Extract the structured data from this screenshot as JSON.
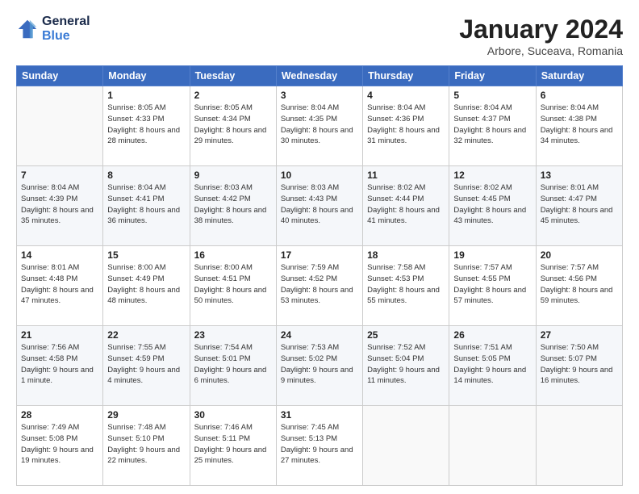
{
  "header": {
    "logo_line1": "General",
    "logo_line2": "Blue",
    "month": "January 2024",
    "location": "Arbore, Suceava, Romania"
  },
  "weekdays": [
    "Sunday",
    "Monday",
    "Tuesday",
    "Wednesday",
    "Thursday",
    "Friday",
    "Saturday"
  ],
  "weeks": [
    [
      {
        "day": "",
        "sunrise": "",
        "sunset": "",
        "daylight": ""
      },
      {
        "day": "1",
        "sunrise": "Sunrise: 8:05 AM",
        "sunset": "Sunset: 4:33 PM",
        "daylight": "Daylight: 8 hours and 28 minutes."
      },
      {
        "day": "2",
        "sunrise": "Sunrise: 8:05 AM",
        "sunset": "Sunset: 4:34 PM",
        "daylight": "Daylight: 8 hours and 29 minutes."
      },
      {
        "day": "3",
        "sunrise": "Sunrise: 8:04 AM",
        "sunset": "Sunset: 4:35 PM",
        "daylight": "Daylight: 8 hours and 30 minutes."
      },
      {
        "day": "4",
        "sunrise": "Sunrise: 8:04 AM",
        "sunset": "Sunset: 4:36 PM",
        "daylight": "Daylight: 8 hours and 31 minutes."
      },
      {
        "day": "5",
        "sunrise": "Sunrise: 8:04 AM",
        "sunset": "Sunset: 4:37 PM",
        "daylight": "Daylight: 8 hours and 32 minutes."
      },
      {
        "day": "6",
        "sunrise": "Sunrise: 8:04 AM",
        "sunset": "Sunset: 4:38 PM",
        "daylight": "Daylight: 8 hours and 34 minutes."
      }
    ],
    [
      {
        "day": "7",
        "sunrise": "Sunrise: 8:04 AM",
        "sunset": "Sunset: 4:39 PM",
        "daylight": "Daylight: 8 hours and 35 minutes."
      },
      {
        "day": "8",
        "sunrise": "Sunrise: 8:04 AM",
        "sunset": "Sunset: 4:41 PM",
        "daylight": "Daylight: 8 hours and 36 minutes."
      },
      {
        "day": "9",
        "sunrise": "Sunrise: 8:03 AM",
        "sunset": "Sunset: 4:42 PM",
        "daylight": "Daylight: 8 hours and 38 minutes."
      },
      {
        "day": "10",
        "sunrise": "Sunrise: 8:03 AM",
        "sunset": "Sunset: 4:43 PM",
        "daylight": "Daylight: 8 hours and 40 minutes."
      },
      {
        "day": "11",
        "sunrise": "Sunrise: 8:02 AM",
        "sunset": "Sunset: 4:44 PM",
        "daylight": "Daylight: 8 hours and 41 minutes."
      },
      {
        "day": "12",
        "sunrise": "Sunrise: 8:02 AM",
        "sunset": "Sunset: 4:45 PM",
        "daylight": "Daylight: 8 hours and 43 minutes."
      },
      {
        "day": "13",
        "sunrise": "Sunrise: 8:01 AM",
        "sunset": "Sunset: 4:47 PM",
        "daylight": "Daylight: 8 hours and 45 minutes."
      }
    ],
    [
      {
        "day": "14",
        "sunrise": "Sunrise: 8:01 AM",
        "sunset": "Sunset: 4:48 PM",
        "daylight": "Daylight: 8 hours and 47 minutes."
      },
      {
        "day": "15",
        "sunrise": "Sunrise: 8:00 AM",
        "sunset": "Sunset: 4:49 PM",
        "daylight": "Daylight: 8 hours and 48 minutes."
      },
      {
        "day": "16",
        "sunrise": "Sunrise: 8:00 AM",
        "sunset": "Sunset: 4:51 PM",
        "daylight": "Daylight: 8 hours and 50 minutes."
      },
      {
        "day": "17",
        "sunrise": "Sunrise: 7:59 AM",
        "sunset": "Sunset: 4:52 PM",
        "daylight": "Daylight: 8 hours and 53 minutes."
      },
      {
        "day": "18",
        "sunrise": "Sunrise: 7:58 AM",
        "sunset": "Sunset: 4:53 PM",
        "daylight": "Daylight: 8 hours and 55 minutes."
      },
      {
        "day": "19",
        "sunrise": "Sunrise: 7:57 AM",
        "sunset": "Sunset: 4:55 PM",
        "daylight": "Daylight: 8 hours and 57 minutes."
      },
      {
        "day": "20",
        "sunrise": "Sunrise: 7:57 AM",
        "sunset": "Sunset: 4:56 PM",
        "daylight": "Daylight: 8 hours and 59 minutes."
      }
    ],
    [
      {
        "day": "21",
        "sunrise": "Sunrise: 7:56 AM",
        "sunset": "Sunset: 4:58 PM",
        "daylight": "Daylight: 9 hours and 1 minute."
      },
      {
        "day": "22",
        "sunrise": "Sunrise: 7:55 AM",
        "sunset": "Sunset: 4:59 PM",
        "daylight": "Daylight: 9 hours and 4 minutes."
      },
      {
        "day": "23",
        "sunrise": "Sunrise: 7:54 AM",
        "sunset": "Sunset: 5:01 PM",
        "daylight": "Daylight: 9 hours and 6 minutes."
      },
      {
        "day": "24",
        "sunrise": "Sunrise: 7:53 AM",
        "sunset": "Sunset: 5:02 PM",
        "daylight": "Daylight: 9 hours and 9 minutes."
      },
      {
        "day": "25",
        "sunrise": "Sunrise: 7:52 AM",
        "sunset": "Sunset: 5:04 PM",
        "daylight": "Daylight: 9 hours and 11 minutes."
      },
      {
        "day": "26",
        "sunrise": "Sunrise: 7:51 AM",
        "sunset": "Sunset: 5:05 PM",
        "daylight": "Daylight: 9 hours and 14 minutes."
      },
      {
        "day": "27",
        "sunrise": "Sunrise: 7:50 AM",
        "sunset": "Sunset: 5:07 PM",
        "daylight": "Daylight: 9 hours and 16 minutes."
      }
    ],
    [
      {
        "day": "28",
        "sunrise": "Sunrise: 7:49 AM",
        "sunset": "Sunset: 5:08 PM",
        "daylight": "Daylight: 9 hours and 19 minutes."
      },
      {
        "day": "29",
        "sunrise": "Sunrise: 7:48 AM",
        "sunset": "Sunset: 5:10 PM",
        "daylight": "Daylight: 9 hours and 22 minutes."
      },
      {
        "day": "30",
        "sunrise": "Sunrise: 7:46 AM",
        "sunset": "Sunset: 5:11 PM",
        "daylight": "Daylight: 9 hours and 25 minutes."
      },
      {
        "day": "31",
        "sunrise": "Sunrise: 7:45 AM",
        "sunset": "Sunset: 5:13 PM",
        "daylight": "Daylight: 9 hours and 27 minutes."
      },
      {
        "day": "",
        "sunrise": "",
        "sunset": "",
        "daylight": ""
      },
      {
        "day": "",
        "sunrise": "",
        "sunset": "",
        "daylight": ""
      },
      {
        "day": "",
        "sunrise": "",
        "sunset": "",
        "daylight": ""
      }
    ]
  ]
}
